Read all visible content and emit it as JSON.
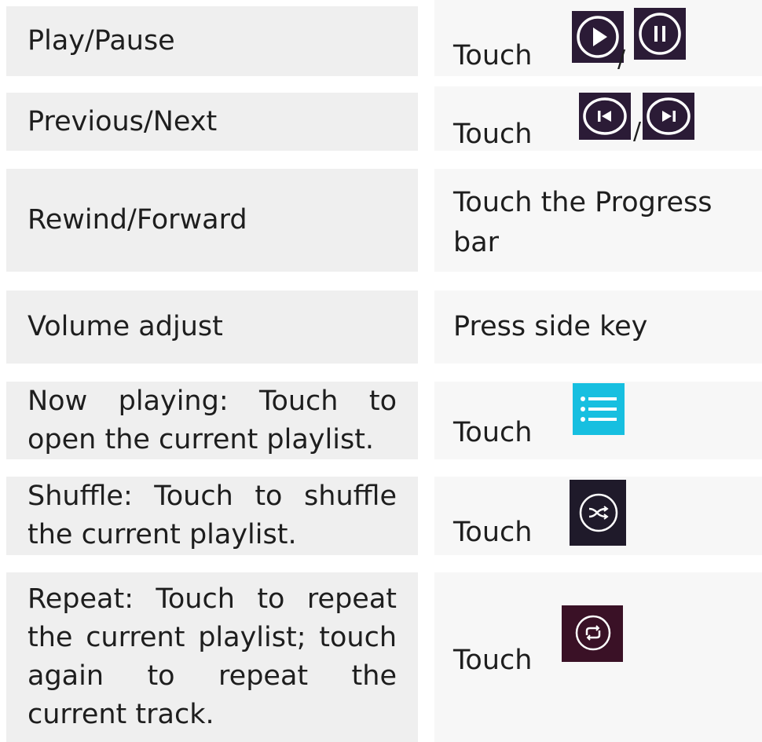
{
  "rows": [
    {
      "function": "Play/Pause",
      "action": "Touch",
      "icons": [
        "play-icon",
        "pause-icon"
      ],
      "separator": "/"
    },
    {
      "function": "Previous/Next",
      "action": "Touch",
      "icons": [
        "skip-previous-icon",
        "skip-next-icon"
      ],
      "separator": "/"
    },
    {
      "function": "Rewind/Forward",
      "action": "Touch the Progress bar"
    },
    {
      "function": "Volume adjust",
      "action": "Press side key"
    },
    {
      "function": "Now playing: Touch to open the current playlist.",
      "action": "Touch",
      "icons": [
        "list-icon"
      ]
    },
    {
      "function": "Shuffle: Touch to shuffle the current playlist.",
      "action": "Touch",
      "icons": [
        "shuffle-icon"
      ]
    },
    {
      "function": "Repeat: Touch to repeat the current playlist; touch again to repeat the current track.",
      "action": "Touch",
      "icons": [
        "repeat-icon"
      ]
    }
  ],
  "colors": {
    "left_cell_bg": "#efefef",
    "right_cell_bg": "#f7f7f7",
    "media_icon_bg": "#2b1b36",
    "list_icon_bg": "#17bfe0",
    "text": "#1e1e1e"
  }
}
